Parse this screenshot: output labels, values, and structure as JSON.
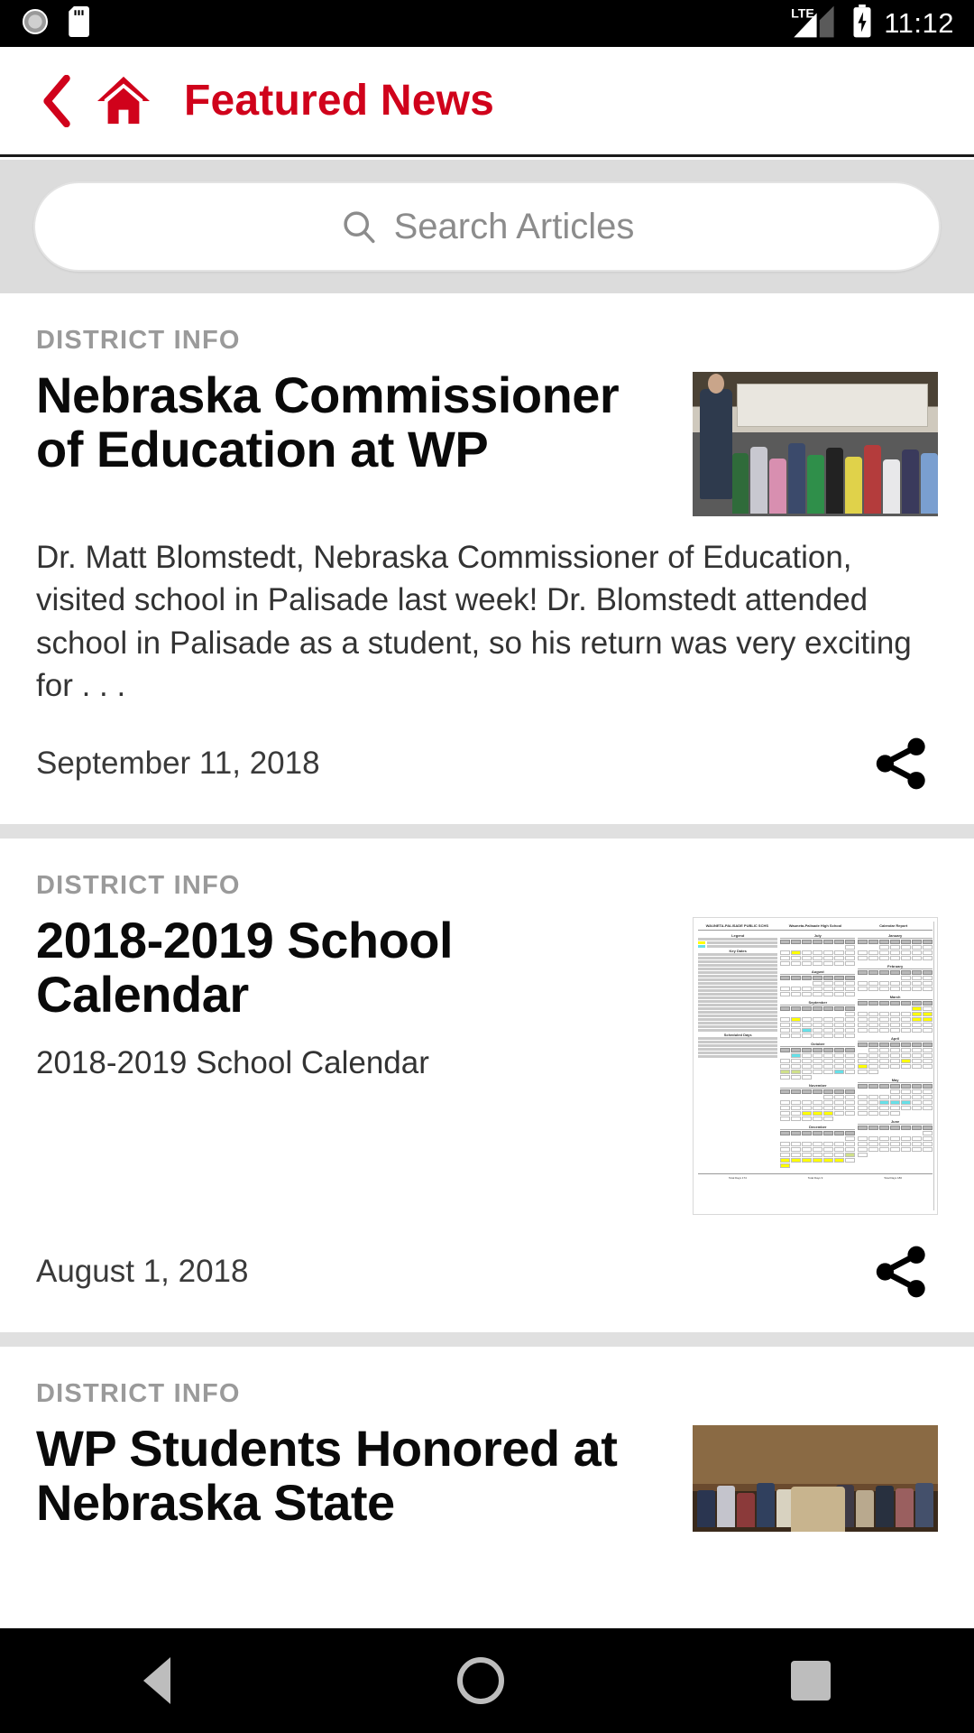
{
  "status_bar": {
    "time": "11:12",
    "network_label": "LTE",
    "icons": [
      "alarm-clock-icon",
      "sd-card-icon",
      "lte-signal-icon",
      "battery-charging-icon"
    ]
  },
  "app_bar": {
    "back_icon": "chevron-left-icon",
    "home_icon": "home-icon",
    "title": "Featured News",
    "accent_color": "#d0021b"
  },
  "search": {
    "placeholder": "Search Articles",
    "value": "",
    "icon": "search-icon"
  },
  "articles": [
    {
      "category": "DISTRICT INFO",
      "headline": "Nebraska Commissioner of Education at WP",
      "summary": "Dr. Matt Blomstedt, Nebraska Commissioner of Education, visited school in Palisade last week! Dr. Blomstedt attended school in Palisade as a student, so his return was very exciting for . . .",
      "date": "September 11, 2018",
      "share_icon": "share-icon",
      "thumbnail": "classroom-group-photo"
    },
    {
      "category": "DISTRICT INFO",
      "headline": "2018-2019 School Calendar",
      "summary": "2018-2019 School Calendar",
      "date": "August 1, 2018",
      "share_icon": "share-icon",
      "thumbnail": "school-calendar-document"
    },
    {
      "category": "DISTRICT INFO",
      "headline": "WP Students Honored at Nebraska State",
      "summary": "",
      "date": "",
      "share_icon": "share-icon",
      "thumbnail": "capitol-group-photo"
    }
  ],
  "calendar_thumb": {
    "title_left": "WAUNETA-PALISADE PUBLIC SCHS",
    "title_center": "Wauneta-Palisade High School",
    "title_right": "Calendar Report",
    "legend_heading": "Legend",
    "key_dates_heading": "Key Dates",
    "scheduled_heading": "Scheduled Days",
    "months": [
      "July",
      "January",
      "August",
      "February",
      "September",
      "March",
      "October",
      "April",
      "November",
      "May",
      "December",
      "June"
    ],
    "footer": [
      "Total Days 174",
      "Total Days 9",
      "Total Days 180"
    ]
  },
  "nav_bar": {
    "back": "nav-back-icon",
    "home": "nav-home-icon",
    "recents": "nav-recents-icon"
  }
}
